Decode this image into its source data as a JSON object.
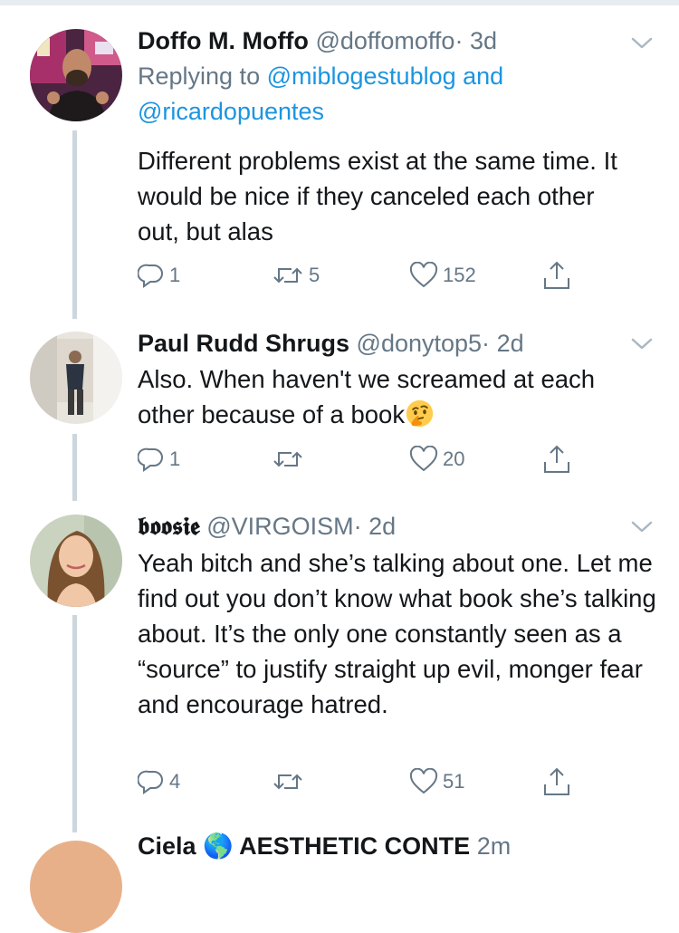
{
  "tweets": [
    {
      "display_name": "Doffo M. Moffo",
      "handle": "@doffomoffo",
      "sep": "·",
      "time": "3d",
      "replying_prefix": "Replying to ",
      "replying_user1": "@miblogestublog",
      "replying_and": " and",
      "replying_user2": "@ricardopuentes",
      "text": "Different problems exist at the same time. It would be nice if they canceled each other out, but alas",
      "replies": "1",
      "retweets": "5",
      "likes": "152",
      "share": ""
    },
    {
      "display_name": "Paul Rudd Shrugs",
      "handle": "@donytop5",
      "sep": "·",
      "time": "2d",
      "text": "Also. When haven't we screamed at each other because of a book",
      "emoji": "thinking-face",
      "replies": "1",
      "retweets": "",
      "likes": "20",
      "share": ""
    },
    {
      "display_name": "𝖇𝖔𝖔𝖘𝖎𝖊",
      "handle": "@VIRGOISM",
      "sep": "·",
      "time": "2d",
      "text": "Yeah bitch and she’s talking about one. Let me find out you don’t know what book she’s talking about. It’s the only one constantly seen as a “source” to justify straight up evil, monger fear and encourage hatred.",
      "replies": "4",
      "retweets": "",
      "likes": "51",
      "share": ""
    }
  ],
  "partial": {
    "display_name": "Ciela 🌎 AESTHETIC CONTE",
    "time": "2m"
  },
  "colors": {
    "link": "#1b95e0",
    "secondary": "#657786",
    "thread_line": "#ccd6dd"
  },
  "icons": [
    "reply-icon",
    "retweet-icon",
    "like-icon",
    "share-icon",
    "chevron-down-icon"
  ]
}
